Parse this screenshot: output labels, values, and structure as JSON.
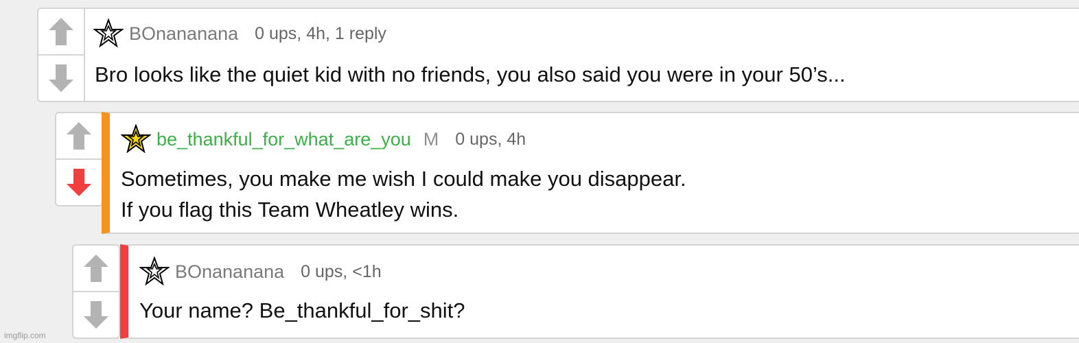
{
  "comments": [
    {
      "username": "BOnananana",
      "meta": "0 ups, 4h, 1 reply",
      "text": [
        "Bro looks like the quiet kid with no friends, you also said you were in your 50’s..."
      ],
      "vote": "none",
      "thread_color": ""
    },
    {
      "username": "be_thankful_for_what_are_you",
      "badge": "M",
      "meta": "0 ups, 4h",
      "text": [
        "Sometimes, you make me wish I could make you disappear.",
        "If you flag this Team Wheatley wins."
      ],
      "vote": "down",
      "thread_color": "#f7921e",
      "username_color": "#3bb046"
    },
    {
      "username": "BOnananana",
      "meta": "0 ups, <1h",
      "text": [
        "Your name? Be_thankful_for_shit?"
      ],
      "vote": "none",
      "thread_color": "#f23e3e"
    }
  ],
  "icons": {
    "upvote": "upvote-arrow-icon",
    "downvote": "downvote-arrow-icon",
    "user_star": "star-badge-icon"
  },
  "colors": {
    "arrow_inactive": "#b3b3b3",
    "arrow_downvoted": "#f23e3e"
  },
  "watermark": "imgflip.com"
}
